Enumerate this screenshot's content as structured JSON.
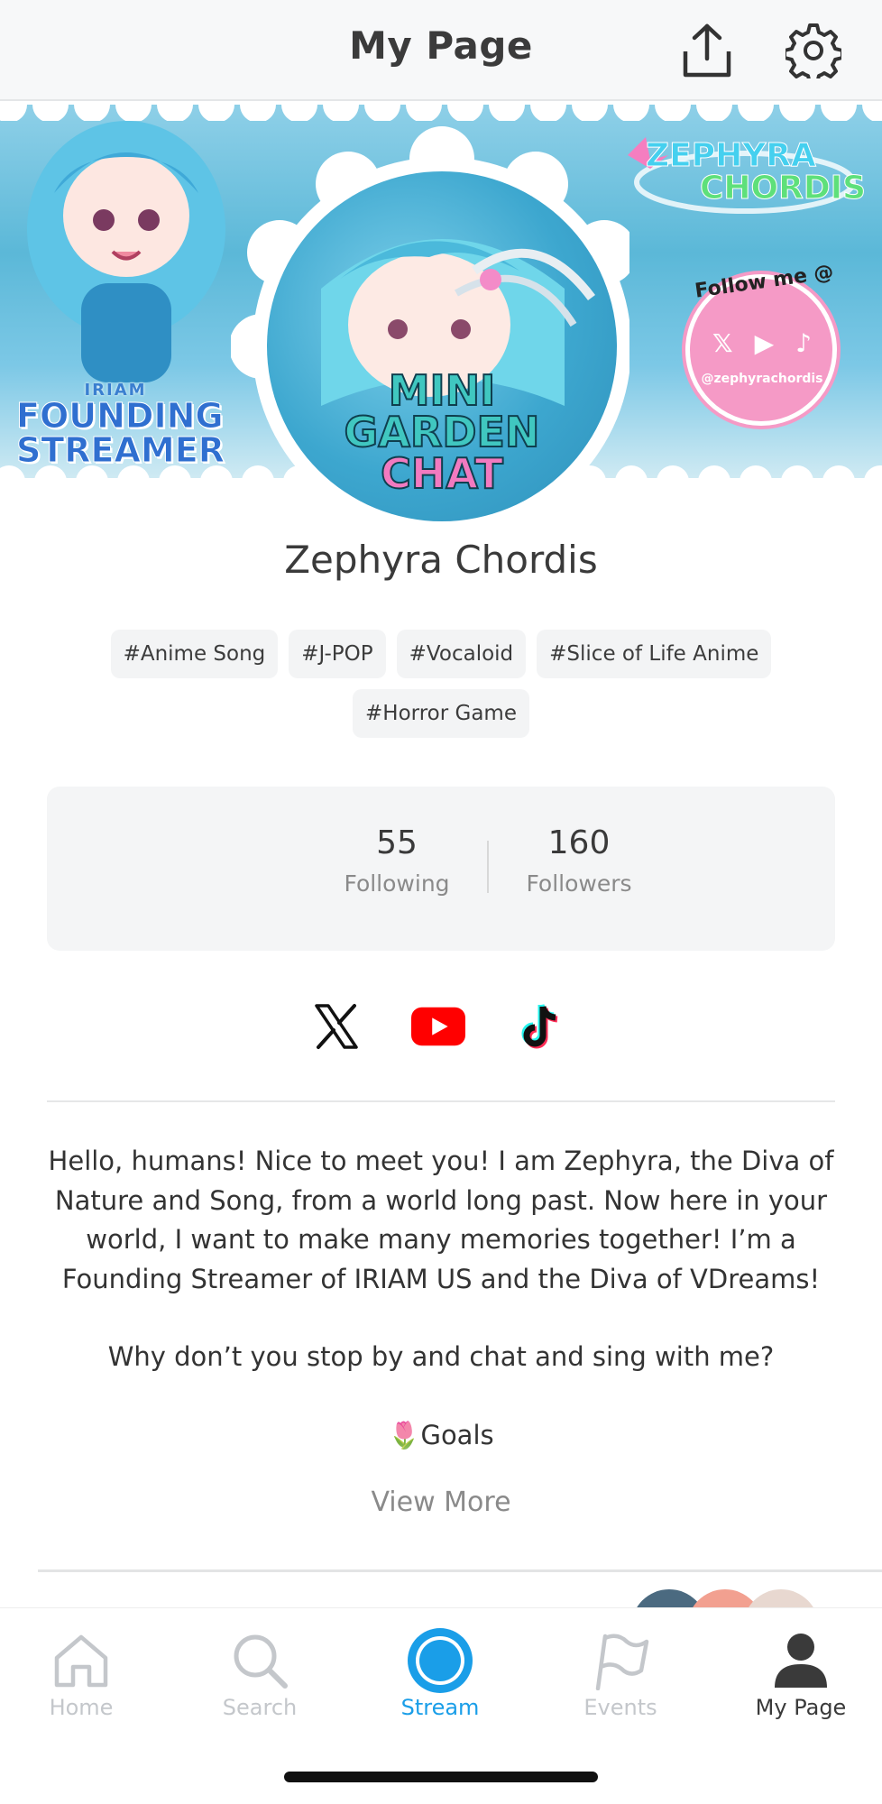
{
  "header": {
    "title": "My Page",
    "share_icon": "share-upload-icon",
    "settings_icon": "gear-icon"
  },
  "banner": {
    "left_badge": {
      "line1": "IRIAM",
      "line2": "FOUNDING",
      "line3": "STREAMER"
    },
    "brand_logo": {
      "line1": "ZEPHYRA",
      "line2": "CHORDIS"
    },
    "follow_badge": {
      "title": "Follow me @",
      "handle": "@zephyrachordis"
    },
    "colors": {
      "sky": "#5bb8d8",
      "pink": "#f59ac6"
    }
  },
  "avatar": {
    "line1": "MINI",
    "line2": "GARDEN",
    "line3": "CHAT"
  },
  "profile": {
    "name": "Zephyra Chordis",
    "tags": [
      "#Anime Song",
      "#J-POP",
      "#Vocaloid",
      "#Slice of Life Anime",
      "#Horror Game"
    ]
  },
  "stats": {
    "following": {
      "value": "55",
      "label": "Following"
    },
    "followers": {
      "value": "160",
      "label": "Followers"
    }
  },
  "social": [
    {
      "name": "x",
      "icon": "x-logo-icon"
    },
    {
      "name": "youtube",
      "icon": "youtube-logo-icon",
      "color": "#ff0000"
    },
    {
      "name": "tiktok",
      "icon": "tiktok-logo-icon"
    }
  ],
  "bio": {
    "paragraph1": "Hello, humans! Nice to meet you! I am Zephyra, the Diva of Nature and Song, from a world long past. Now here in your world, I want to make many memories together! I’m a Founding Streamer of IRIAM US and the Diva of VDreams!",
    "paragraph2": "Why don’t you stop by and chat and sing with me?",
    "paragraph3": "🌷Goals",
    "view_more": "View More"
  },
  "bottom_nav": {
    "items": [
      {
        "label": "Home",
        "icon": "home-icon"
      },
      {
        "label": "Search",
        "icon": "search-icon"
      },
      {
        "label": "Stream",
        "icon": "stream-icon"
      },
      {
        "label": "Events",
        "icon": "flag-icon"
      },
      {
        "label": "My Page",
        "icon": "person-icon"
      }
    ],
    "active_color": "#1a9ee8",
    "inactive_color": "#c4c7cb"
  }
}
